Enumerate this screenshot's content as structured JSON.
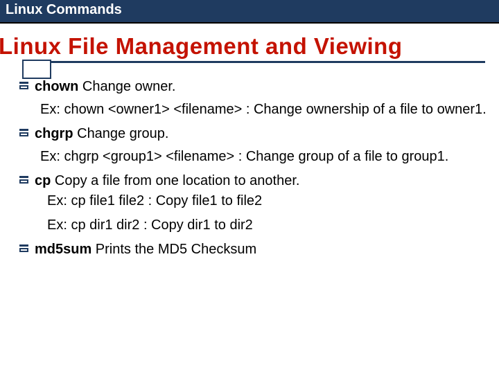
{
  "header": "Linux Commands",
  "title": "Linux File Management and Viewing",
  "section": {
    "chown": {
      "cmd": "chown",
      "desc": " Change owner.",
      "ex": "Ex: chown <owner1> <filename> : Change ownership of a file to owner1."
    },
    "chgrp": {
      "cmd": "chgrp",
      "desc": " Change group.",
      "ex": "Ex: chgrp <group1> <filename> : Change group of a file to group1."
    },
    "cp": {
      "cmd": "cp",
      "desc": " Copy a file from one location to another.",
      "ex1": "Ex: cp file1 file2 : Copy file1 to file2",
      "ex2": "Ex: cp  dir1 dir2 : Copy dir1 to dir2"
    },
    "md5sum": {
      "cmd": "md5sum",
      "desc": " Prints the MD5 Checksum"
    }
  }
}
